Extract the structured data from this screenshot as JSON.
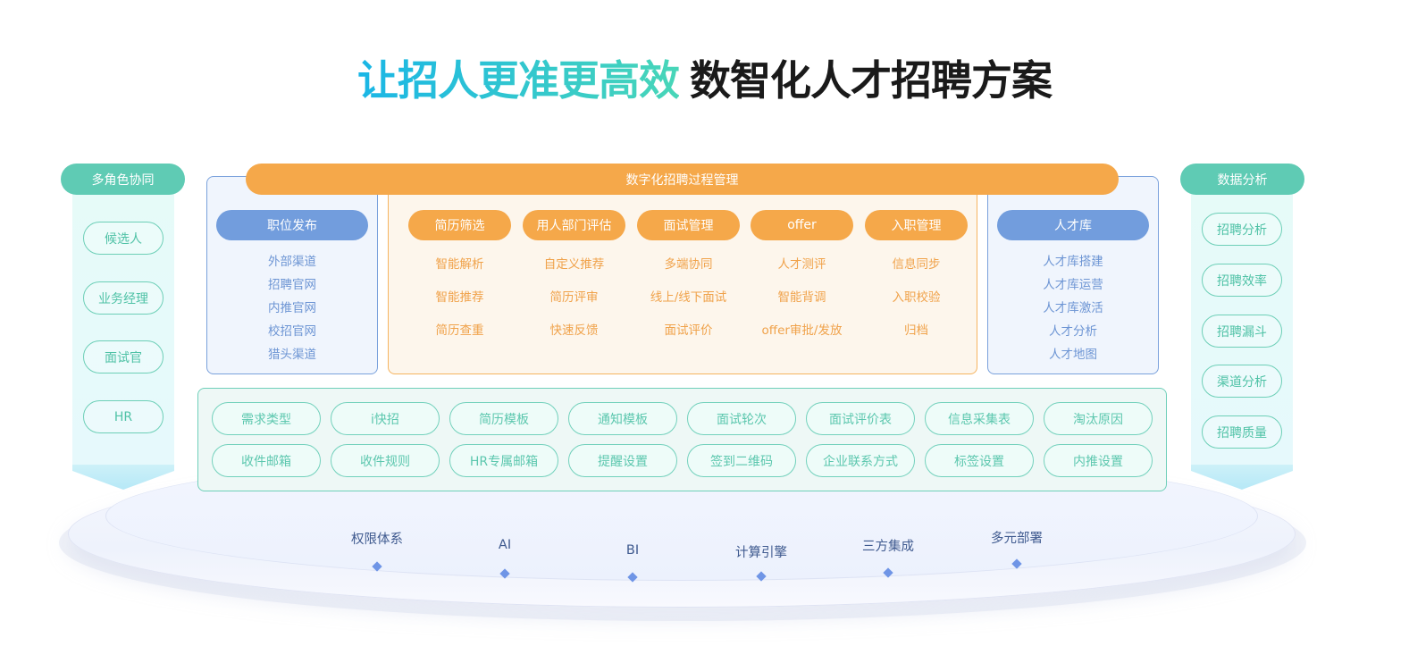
{
  "title": {
    "highlight": "让招人更准更高效",
    "main": "数智化人才招聘方案"
  },
  "left_column": {
    "header": "多角色协同",
    "roles": [
      "候选人",
      "业务经理",
      "面试官",
      "HR"
    ]
  },
  "right_column": {
    "header": "数据分析",
    "items": [
      "招聘分析",
      "招聘效率",
      "招聘漏斗",
      "渠道分析",
      "招聘质量"
    ]
  },
  "process_banner": "数字化招聘过程管理",
  "job_posting": {
    "header": "职位发布",
    "items": [
      "外部渠道",
      "招聘官网",
      "内推官网",
      "校招官网",
      "猎头渠道"
    ]
  },
  "process_modules": [
    {
      "header": "简历筛选",
      "items": [
        "智能解析",
        "智能推荐",
        "简历查重"
      ]
    },
    {
      "header": "用人部门评估",
      "items": [
        "自定义推荐",
        "简历评审",
        "快速反馈"
      ]
    },
    {
      "header": "面试管理",
      "items": [
        "多端协同",
        "线上/线下面试",
        "面试评价"
      ]
    },
    {
      "header": "offer",
      "items": [
        "人才测评",
        "智能背调",
        "offer审批/发放"
      ]
    },
    {
      "header": "入职管理",
      "items": [
        "信息同步",
        "入职校验",
        "归档"
      ]
    }
  ],
  "talent_pool": {
    "header": "人才库",
    "items": [
      "人才库搭建",
      "人才库运营",
      "人才库激活",
      "人才分析",
      "人才地图"
    ]
  },
  "config_settings": [
    [
      "需求类型",
      "i快招",
      "简历模板",
      "通知模板",
      "面试轮次",
      "面试评价表",
      "信息采集表",
      "淘汰原因"
    ],
    [
      "收件邮箱",
      "收件规则",
      "HR专属邮箱",
      "提醒设置",
      "签到二维码",
      "企业联系方式",
      "标签设置",
      "内推设置"
    ]
  ],
  "foundation": [
    "权限体系",
    "AI",
    "BI",
    "计算引擎",
    "三方集成",
    "多元部署"
  ],
  "colors": {
    "teal": "#5fcbb4",
    "orange": "#f5a84a",
    "blue": "#729ddd",
    "foundation_text": "#3f5a8f",
    "title_gradient_start": "#1ab6e6",
    "title_gradient_end": "#48d6b8"
  }
}
